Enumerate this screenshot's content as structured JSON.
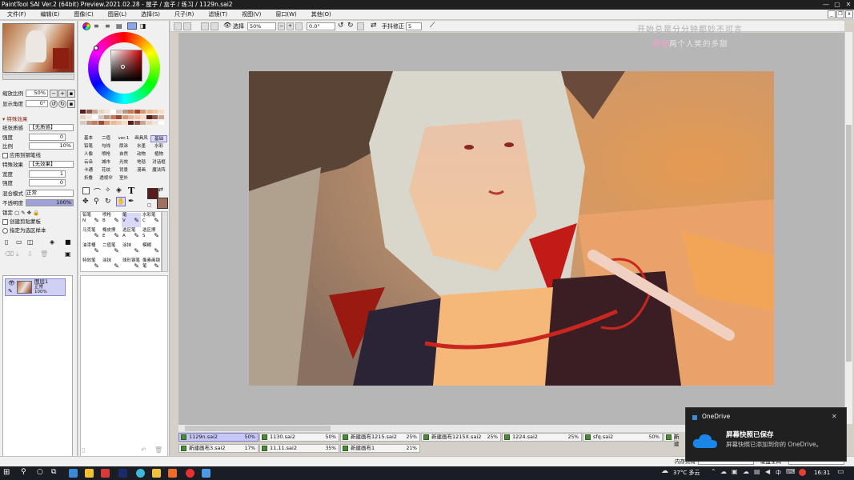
{
  "title": "PaintTool SAI Ver.2 (64bit) Preview.2021.02.28 - 屋子 / 盒子 / 练习 / 1129n.sai2",
  "menu": [
    "文件(F)",
    "编辑(E)",
    "图像(C)",
    "图层(L)",
    "选择(S)",
    "尺子(R)",
    "滤镜(T)",
    "视图(V)",
    "窗口(W)",
    "其他(O)"
  ],
  "navigator": {
    "zoom_label": "缩放比例",
    "zoom_value": "50%",
    "angle_label": "显示角度",
    "angle_value": "0°"
  },
  "effects": {
    "header": "特殊效果",
    "paper_label": "纸张质感",
    "paper_value": "【无质感】",
    "strength_label": "强度",
    "strength_value": "0",
    "ratio_label": "比例",
    "ratio_value": "10%",
    "apply_brush": "应用到钢笔线",
    "effect_label": "特殊效果",
    "effect_value": "【无效果】",
    "width_label": "宽度",
    "width_value": "1",
    "intensity_label": "强度",
    "intensity_value": "0"
  },
  "layer_props": {
    "blend_label": "混合模式",
    "blend_value": "正常",
    "opacity_label": "不透明度",
    "opacity_value": "100%",
    "lock_label": "锁定",
    "clip_label": "创建剪贴蒙板",
    "select_source": "指定为选区样本"
  },
  "layer": {
    "name": "图层1",
    "mode": "正常",
    "opacity": "100%"
  },
  "brush_tabs": [
    "基本",
    "二值",
    "ver.1",
    "画具风",
    "基础",
    "铅笔",
    "勾线",
    "厚涂",
    "水墨",
    "水彩",
    "人像",
    "喷枪",
    "自然",
    "动物",
    "植物",
    "云朵",
    "城市",
    "光效",
    "地毯",
    "对话框",
    "卡通",
    "花纹",
    "背景",
    "漫画",
    "魔法阵",
    "折叠",
    "透视伞",
    "室外"
  ],
  "tools": [
    {
      "name": "铅笔",
      "key": "N"
    },
    {
      "name": "喷枪",
      "key": "B"
    },
    {
      "name": "笔",
      "key": "V"
    },
    {
      "name": "水彩笔",
      "key": "C"
    },
    {
      "name": "马克笔",
      "key": ""
    },
    {
      "name": "橡皮擦",
      "key": "E"
    },
    {
      "name": "选区笔",
      "key": "A"
    },
    {
      "name": "选区擦",
      "key": "S"
    },
    {
      "name": "油漆桶",
      "key": ""
    },
    {
      "name": "二值笔",
      "key": ""
    },
    {
      "name": "涂抹",
      "key": ""
    },
    {
      "name": "模糊",
      "key": ""
    },
    {
      "name": "特效笔",
      "key": ""
    },
    {
      "name": "涂抹",
      "key": ""
    },
    {
      "name": "球形钢笔",
      "key": ""
    },
    {
      "name": "像素画钢笔",
      "key": ""
    }
  ],
  "options": {
    "selection_label": "选择",
    "zoom_value": "50%",
    "angle_value": "0.0°",
    "stabilizer_label": "手抖修正",
    "stabilizer_value": "5"
  },
  "watermark": {
    "line1": "开始总是分分钟都妙不可言",
    "line2_pink": "傻傻",
    "line2_rest": "两个人笑的多甜"
  },
  "file_tabs": [
    {
      "name": "1129n.sai2",
      "percent": "50%",
      "active": true
    },
    {
      "name": "1130.sai2",
      "percent": "50%",
      "active": false
    },
    {
      "name": "新建画布1215.sai2",
      "percent": "25%",
      "active": false
    },
    {
      "name": "新建画布1215X.sai2",
      "percent": "25%",
      "active": false
    },
    {
      "name": "1224.sai2",
      "percent": "25%",
      "active": false
    },
    {
      "name": "sfq.sai2",
      "percent": "50%",
      "active": false
    },
    {
      "name": "新建",
      "percent": "",
      "active": false
    },
    {
      "name": "新建画布3.sai2",
      "percent": "17%",
      "active": false
    },
    {
      "name": "11.11.sai2",
      "percent": "35%",
      "active": false
    },
    {
      "name": "新建画布1",
      "percent": "21%",
      "active": false
    }
  ],
  "statusbar": {
    "memory_label": "内存负荷",
    "disk_label": "硬盘空间"
  },
  "taskbar": {
    "weather": "37°C 多云",
    "ime": "中",
    "time": "16:31"
  },
  "toast": {
    "app": "OneDrive",
    "heading": "屏幕快照已保存",
    "body": "屏幕快照已添加到你的 OneDrive。"
  },
  "colors": {
    "primary": "#5a1c1c",
    "secondary": "#a07060",
    "accent": "#c8c8f8"
  }
}
